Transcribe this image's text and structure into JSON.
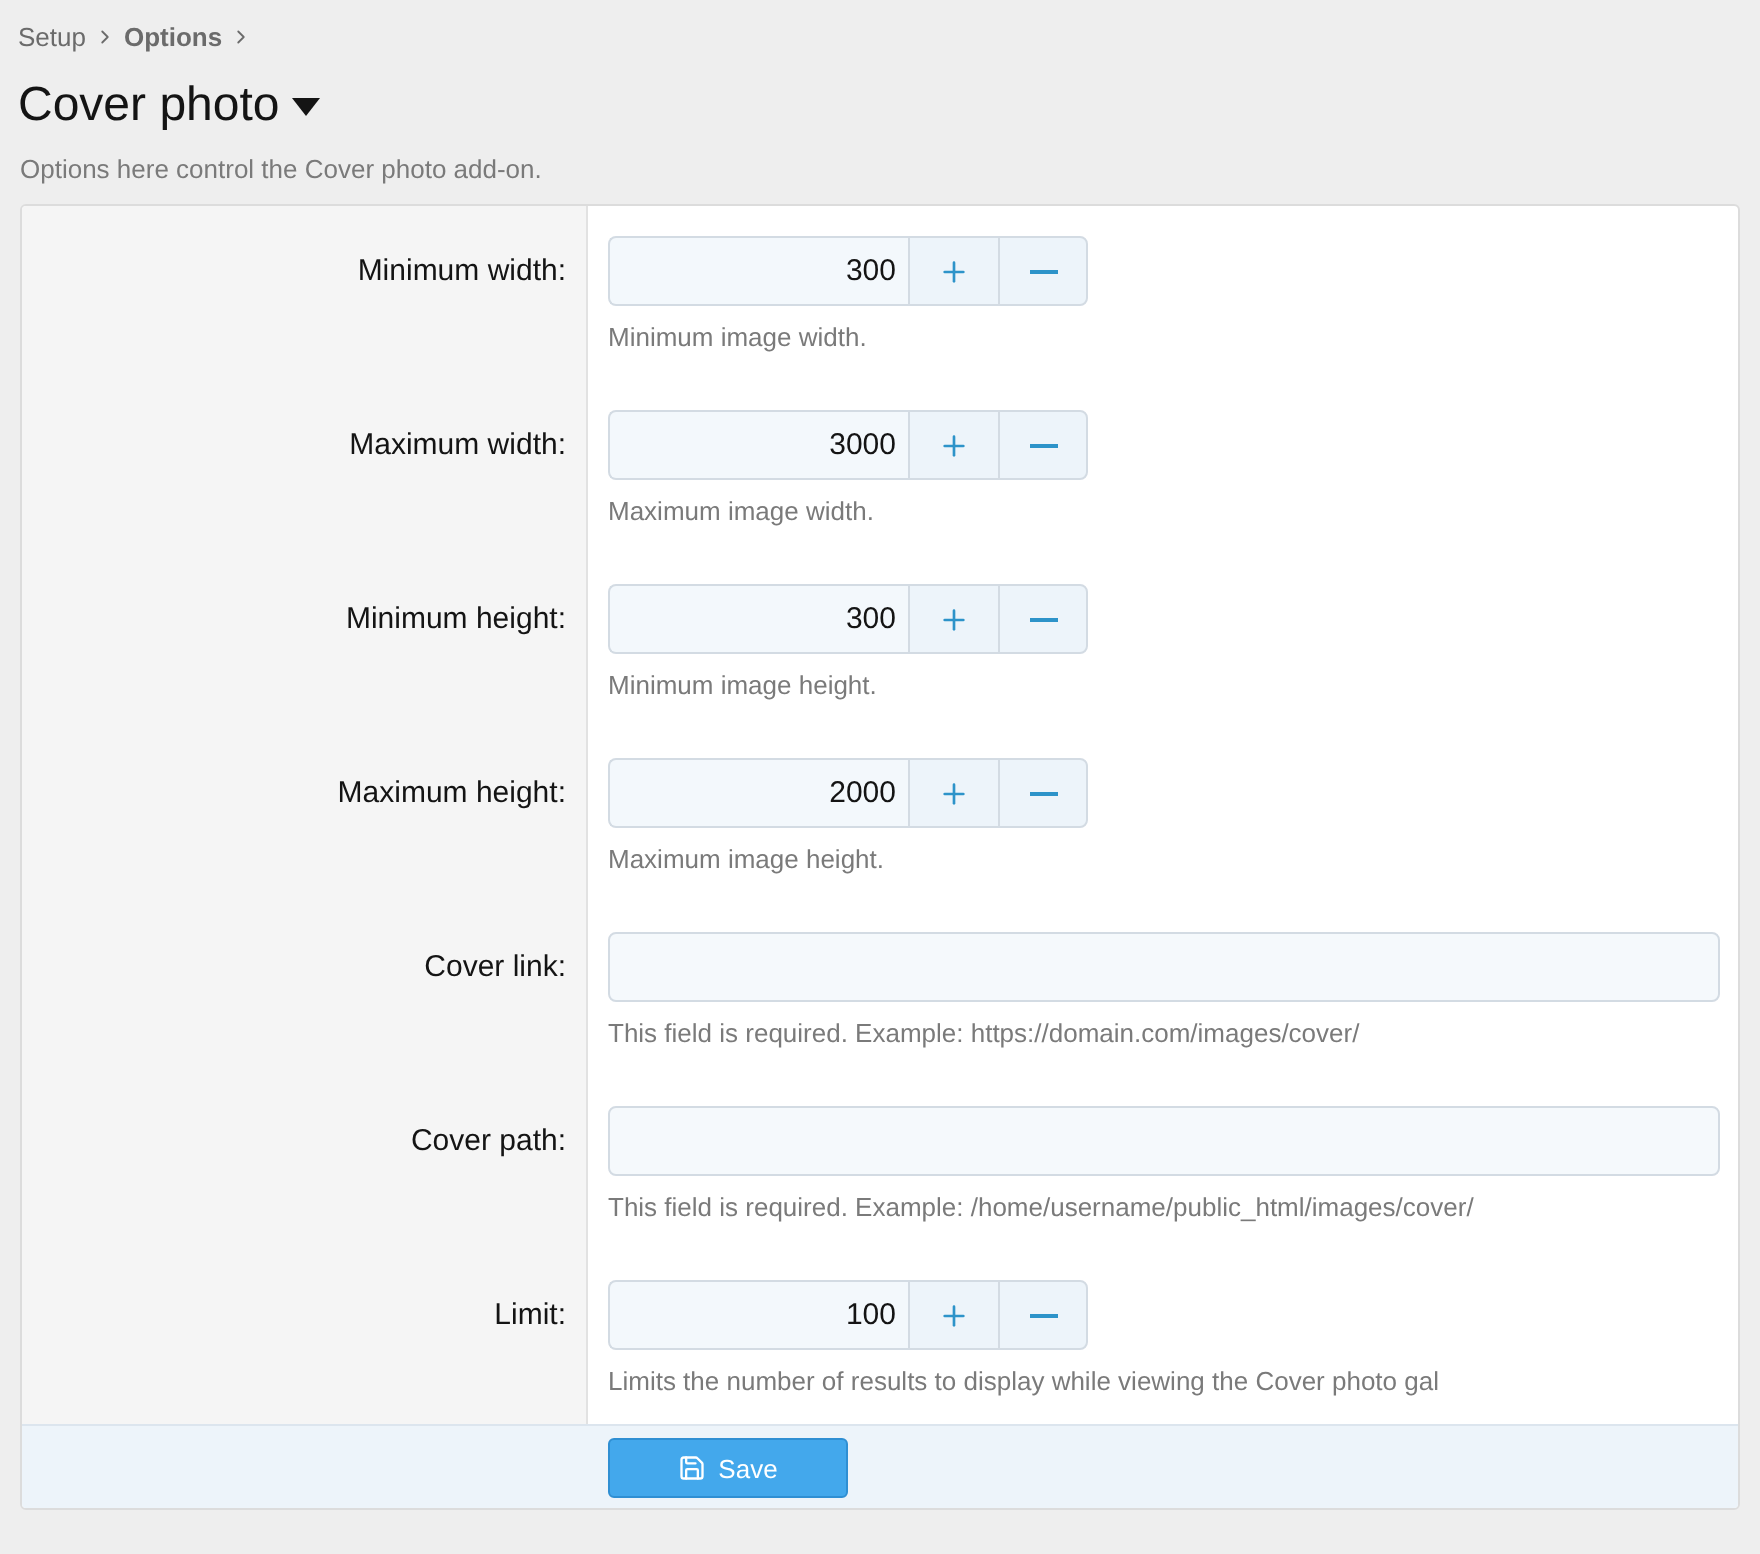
{
  "breadcrumb": [
    {
      "label": "Setup"
    },
    {
      "label": "Options"
    }
  ],
  "title": "Cover photo",
  "description": "Options here control the Cover photo add-on.",
  "options": [
    {
      "kind": "number",
      "label": "Minimum width:",
      "value": "300",
      "hint": "Minimum image width."
    },
    {
      "kind": "number",
      "label": "Maximum width:",
      "value": "3000",
      "hint": "Maximum image width."
    },
    {
      "kind": "number",
      "label": "Minimum height:",
      "value": "300",
      "hint": "Minimum image height."
    },
    {
      "kind": "number",
      "label": "Maximum height:",
      "value": "2000",
      "hint": "Maximum image height."
    },
    {
      "kind": "text",
      "label": "Cover link:",
      "hint": "This field is required. Example: https://domain.com/images/cover/"
    },
    {
      "kind": "text",
      "label": "Cover path:",
      "hint": "This field is required. Example: /home/username/public_html/images/cover/"
    },
    {
      "kind": "number",
      "label": "Limit:",
      "value": "100",
      "hint": "Limits the number of results to display while viewing the Cover photo gal"
    }
  ],
  "save_button": "Save"
}
